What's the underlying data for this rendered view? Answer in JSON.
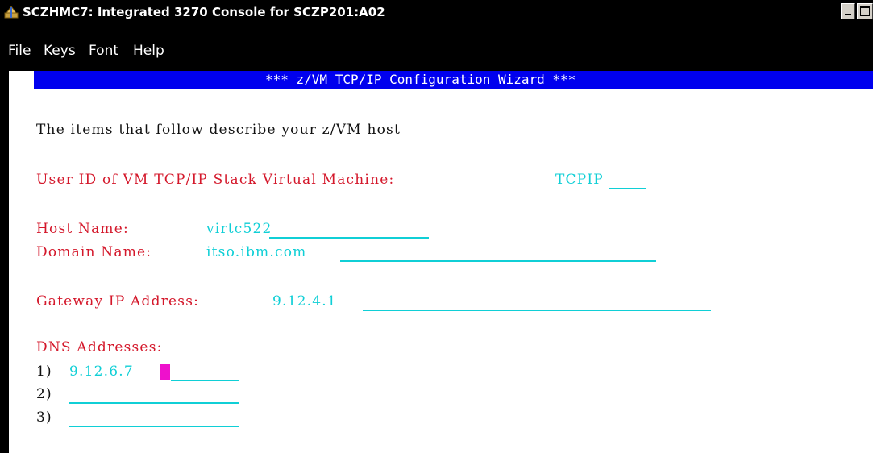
{
  "window": {
    "title": "SCZHMC7: Integrated 3270 Console for SCZP201:A02"
  },
  "menu": {
    "items": [
      "File",
      "Keys",
      "Font",
      "Help"
    ]
  },
  "screen": {
    "banner": "*** z/VM TCP/IP Configuration Wizard ***",
    "intro": "The items that follow describe your z/VM host",
    "fields": {
      "userid_label": "User ID of VM TCP/IP Stack Virtual Machine:",
      "userid_value": "TCPIP",
      "host_label": "Host Name:",
      "host_value": "virtc522",
      "domain_label": "Domain Name:",
      "domain_value": "itso.ibm.com",
      "gateway_label": "Gateway IP Address:",
      "gateway_value": "9.12.4.1",
      "dns_label": "DNS Addresses:",
      "dns": [
        {
          "index": "1)",
          "value": "9.12.6.7"
        },
        {
          "index": "2)",
          "value": ""
        },
        {
          "index": "3)",
          "value": ""
        }
      ]
    }
  },
  "colors": {
    "label": "#d4182b",
    "input": "#10cfd6",
    "banner_bg": "#0000ee",
    "cursor": "#ee11cc"
  }
}
